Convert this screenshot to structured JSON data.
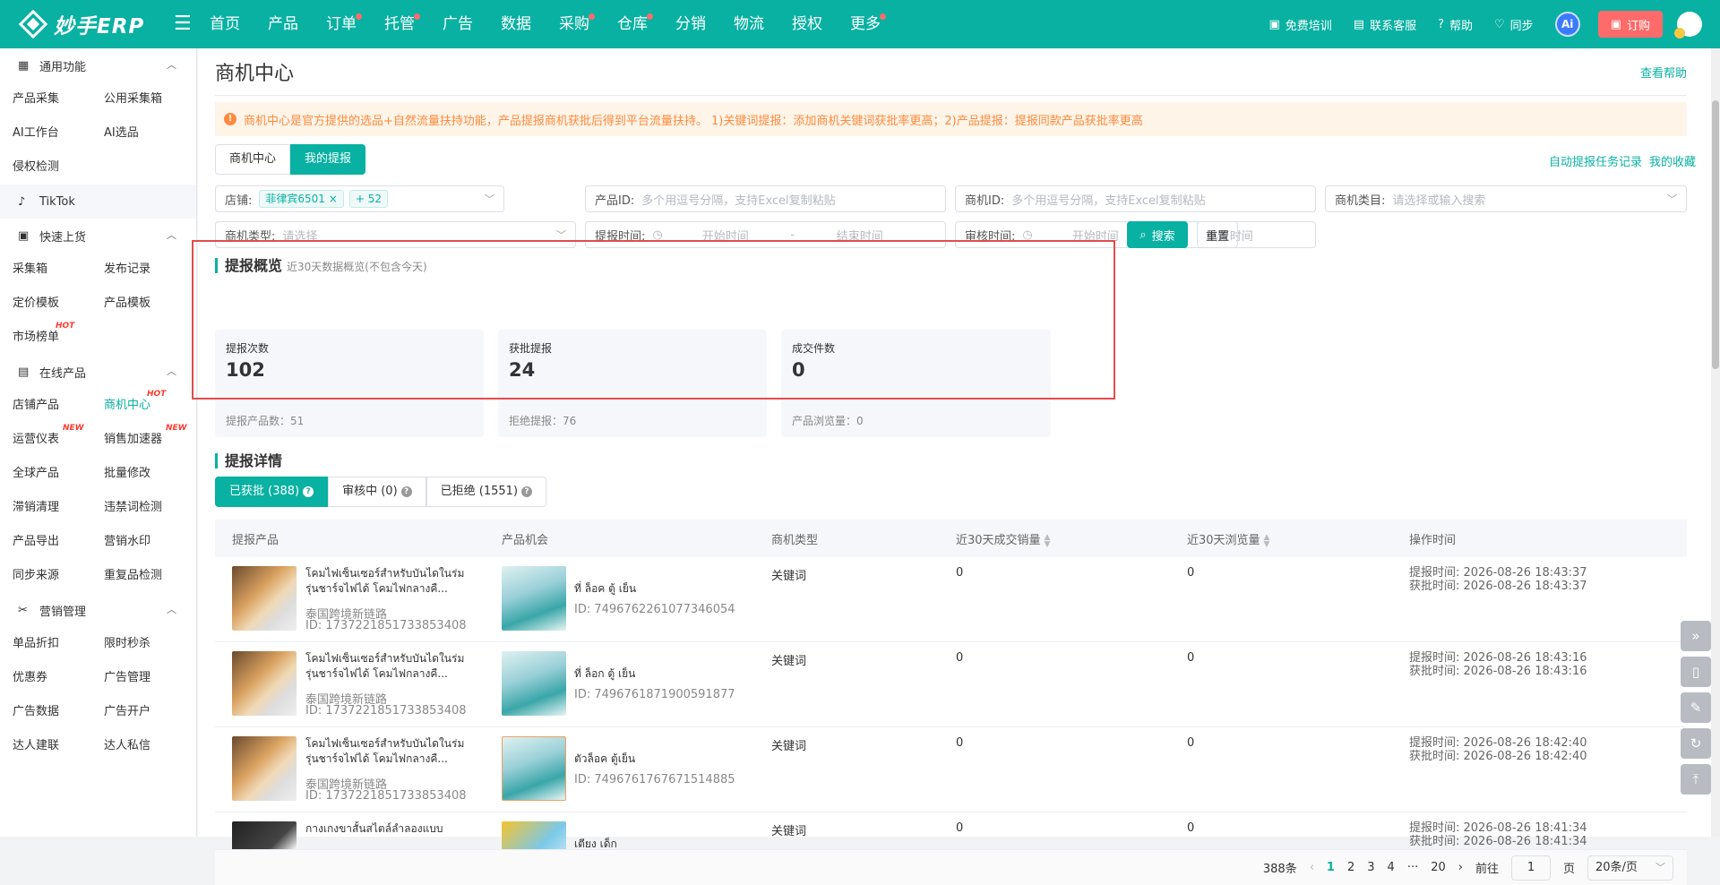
{
  "topbar": {
    "logo_text": "妙手ERP",
    "nav": [
      {
        "label": "首页",
        "dot": false
      },
      {
        "label": "产品",
        "dot": false
      },
      {
        "label": "订单",
        "dot": true
      },
      {
        "label": "托管",
        "dot": true
      },
      {
        "label": "广告",
        "dot": false
      },
      {
        "label": "数据",
        "dot": false
      },
      {
        "label": "采购",
        "dot": true
      },
      {
        "label": "仓库",
        "dot": true
      },
      {
        "label": "分销",
        "dot": false
      },
      {
        "label": "物流",
        "dot": false
      },
      {
        "label": "授权",
        "dot": false
      },
      {
        "label": "更多",
        "dot": true
      }
    ],
    "tools": {
      "training": "免费培训",
      "service": "联系客服",
      "help": "帮助",
      "sync": "同步",
      "ai": "Ai",
      "order": "订购"
    }
  },
  "sidebar": {
    "general": {
      "title": "通用功能",
      "items": [
        "产品采集",
        "公用采集箱",
        "AI工作台",
        "AI选品",
        "侵权检测"
      ]
    },
    "tiktok": {
      "title": "TikTok"
    },
    "quick": {
      "title": "快速上货",
      "items": [
        "采集箱",
        "发布记录",
        "定价模板",
        "产品模板",
        "市场榜单"
      ],
      "hot_tag": "HOT"
    },
    "online": {
      "title": "在线产品",
      "items": [
        "店铺产品",
        "商机中心",
        "运营仪表",
        "销售加速器",
        "全球产品",
        "批量修改",
        "滞销清理",
        "违禁词检测",
        "产品导出",
        "营销水印",
        "同步来源",
        "重复品检测"
      ],
      "hot_tag": "HOT",
      "new_tag": "NEW"
    },
    "marketing": {
      "title": "营销管理",
      "items": [
        "单品折扣",
        "限时秒杀",
        "优惠券",
        "广告管理",
        "广告数据",
        "广告开户",
        "达人建联",
        "达人私信"
      ]
    }
  },
  "main": {
    "title": "商机中心",
    "help_link": "查看帮助",
    "notice": "商机中心是官方提供的选品+自然流量扶持功能，产品提报商机获批后得到平台流量扶持。 1)关键词提报：添加商机关键词获批率更高；2)产品提报：提报同款产品获批率更高",
    "tabs": [
      "商机中心",
      "我的提报"
    ],
    "right_links": [
      "自动提报任务记录",
      "我的收藏"
    ],
    "filters": {
      "shop_label": "店铺:",
      "shop_chip": "菲律宾6501",
      "shop_more": "+ 52",
      "product_id_label": "产品ID:",
      "product_id_ph": "多个用逗号分隔，支持Excel复制粘贴",
      "opp_id_label": "商机ID:",
      "opp_id_ph": "多个用逗号分隔，支持Excel复制粘贴",
      "category_label": "商机类目:",
      "category_ph": "请选择或输入搜索",
      "type_label": "商机类型:",
      "type_ph": "请选择",
      "submit_time_label": "提报时间:",
      "review_time_label": "审核时间:",
      "start_ph": "开始时间",
      "end_ph": "结束时间",
      "range_sep": "-",
      "search": "搜索",
      "reset": "重置"
    },
    "overview": {
      "title": "提报概览",
      "subtitle": "近30天数据概览(不包含今天)",
      "cards": [
        {
          "label": "提报次数",
          "value": "102",
          "foot": "提报产品数：51"
        },
        {
          "label": "获批提报",
          "value": "24",
          "foot": "拒绝提报：76"
        },
        {
          "label": "成交件数",
          "value": "0",
          "foot": "产品浏览量：0"
        }
      ]
    },
    "details": {
      "title": "提报详情",
      "tabs": [
        "已获批 (388)",
        "审核中 (0)",
        "已拒绝 (1551)"
      ],
      "columns": [
        "提报产品",
        "产品机会",
        "商机类型",
        "近30天成交销量",
        "近30天浏览量",
        "操作时间"
      ],
      "rows": [
        {
          "product_name": "โคมไฟเซ็นเซอร์สำหรับบันไดในร่ม รุ่นชาร์จไฟได้ โคมไฟกลางคื...",
          "shop": "泰国跨境新链路",
          "product_id": "ID: 1737221851733853408",
          "opp_name": "ที่ ล็อค ตู้ เย็น",
          "opp_id": "ID: 7496762261077346054",
          "type": "关键词",
          "sales": "0",
          "views": "0",
          "submit_time": "提报时间: 2026-08-26 18:43:37",
          "approve_time": "获批时间: 2026-08-26 18:43:37"
        },
        {
          "product_name": "โคมไฟเซ็นเซอร์สำหรับบันไดในร่ม รุ่นชาร์จไฟได้ โคมไฟกลางคื...",
          "shop": "泰国跨境新链路",
          "product_id": "ID: 1737221851733853408",
          "opp_name": "ที่ ล็อก ตู้ เย็น",
          "opp_id": "ID: 7496761871900591877",
          "type": "关键词",
          "sales": "0",
          "views": "0",
          "submit_time": "提报时间: 2026-08-26 18:43:16",
          "approve_time": "获批时间: 2026-08-26 18:43:16"
        },
        {
          "product_name": "โคมไฟเซ็นเซอร์สำหรับบันไดในร่ม รุ่นชาร์จไฟได้ โคมไฟกลางคื...",
          "shop": "泰国跨境新链路",
          "product_id": "ID: 1737221851733853408",
          "opp_name": "ตัวล็อค ตู้เย็น",
          "opp_id": "ID: 7496761767671514885",
          "type": "关键词",
          "sales": "0",
          "views": "0",
          "submit_time": "提报时间: 2026-08-26 18:42:40",
          "approve_time": "获批时间: 2026-08-26 18:42:40"
        },
        {
          "product_name": "กางเกงขาสั้นสไตล์ลำลองแบบ",
          "shop": "",
          "product_id": "",
          "opp_name": "เตียง เด็ก",
          "opp_id": "",
          "type": "关键词",
          "sales": "0",
          "views": "0",
          "submit_time": "提报时间: 2026-08-26 18:41:34",
          "approve_time": "获批时间: 2026-08-26 18:41:34"
        }
      ]
    },
    "pagination": {
      "total": "388条",
      "pages": [
        "1",
        "2",
        "3",
        "4",
        "···",
        "20"
      ],
      "goto_label": "前往",
      "goto_value": "1",
      "page_unit": "页",
      "page_size": "20条/页"
    }
  }
}
